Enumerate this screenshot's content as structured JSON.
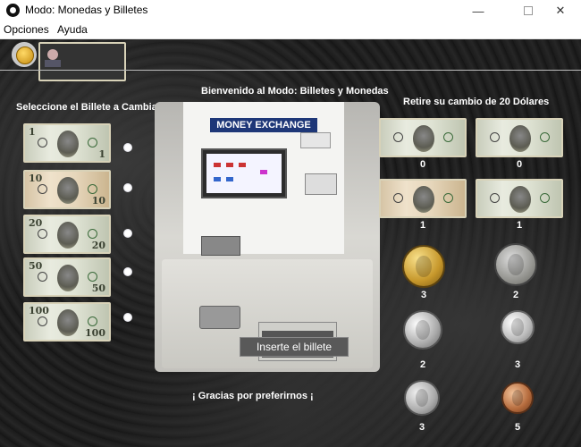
{
  "window": {
    "title": "Modo: Monedas y Billetes",
    "min": "—",
    "close": "✕"
  },
  "menu": {
    "opciones": "Opciones",
    "ayuda": "Ayuda"
  },
  "welcome": "Bienvenido al Modo: Billetes y Monedas",
  "select_label": "Seleccione el Billete a Cambiar",
  "change_label": "Retire su cambio de 20 Dólares",
  "machine": {
    "header": "MONEY EXCHANGE"
  },
  "insert_button": "Inserte el billete",
  "footer": "¡ Gracias por preferirnos ¡",
  "bills_left": [
    {
      "name": "bill-1",
      "value": "1"
    },
    {
      "name": "bill-10",
      "value": "10"
    },
    {
      "name": "bill-20",
      "value": "20"
    },
    {
      "name": "bill-50",
      "value": "50"
    },
    {
      "name": "bill-100",
      "value": "100"
    }
  ],
  "change": {
    "bill_20": "0",
    "bill_5": "0",
    "bill_10": "1",
    "bill_5b": "1",
    "coin_dollar": "3",
    "coin_half": "2",
    "coin_quarter": "2",
    "coin_dime": "3",
    "coin_nickel": "3",
    "coin_penny": "5"
  },
  "colors": {
    "background": "#1a1a1a",
    "text": "#ffffff",
    "button": "#595959",
    "header": "#1e3778"
  }
}
